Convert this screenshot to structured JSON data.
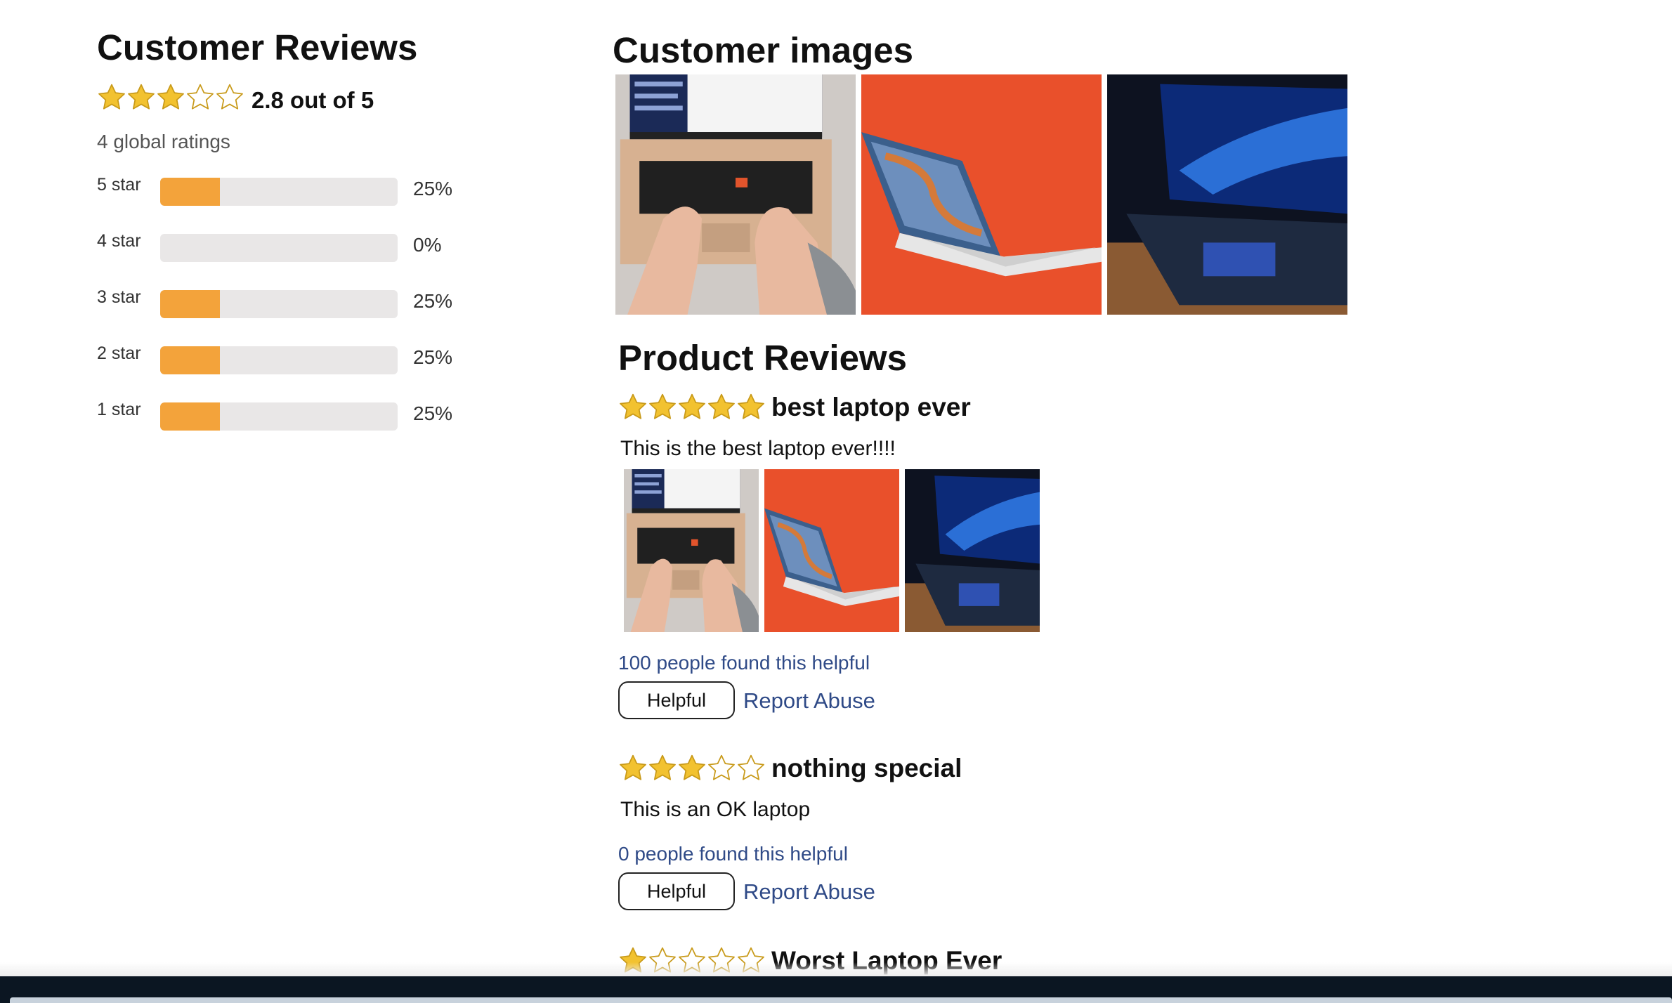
{
  "summary": {
    "title": "Customer Reviews",
    "rating": 2.8,
    "rating_text": "2.8 out of 5",
    "global_ratings": "4 global ratings",
    "histogram": [
      {
        "label": "5 star",
        "percent": 25,
        "percent_text": "25%"
      },
      {
        "label": "4 star",
        "percent": 0,
        "percent_text": "0%"
      },
      {
        "label": "3 star",
        "percent": 25,
        "percent_text": "25%"
      },
      {
        "label": "2 star",
        "percent": 25,
        "percent_text": "25%"
      },
      {
        "label": "1 star",
        "percent": 25,
        "percent_text": "25%"
      }
    ]
  },
  "customer_images": {
    "title": "Customer images",
    "images": [
      "laptop-typing-photo",
      "laptop-orange-background-photo",
      "laptop-dark-desk-photo"
    ]
  },
  "product_reviews": {
    "title": "Product Reviews",
    "reviews": [
      {
        "stars": 5,
        "title": "best laptop ever",
        "body": "This is the best laptop ever!!!!",
        "has_images": true,
        "helpful_text": "100 people found this helpful",
        "helpful_button": "Helpful",
        "report_label": "Report Abuse"
      },
      {
        "stars": 3,
        "title": "nothing special",
        "body": "This is an OK laptop",
        "has_images": false,
        "helpful_text": "0 people found this helpful",
        "helpful_button": "Helpful",
        "report_label": "Report Abuse"
      },
      {
        "stars": 1,
        "title": "Worst Laptop Ever"
      }
    ]
  },
  "colors": {
    "star_fill": "#f2c230",
    "star_stroke": "#c89a1a",
    "bar_fill": "#f3a33b",
    "bar_track": "#e9e7e7",
    "link": "#2f4a87"
  }
}
